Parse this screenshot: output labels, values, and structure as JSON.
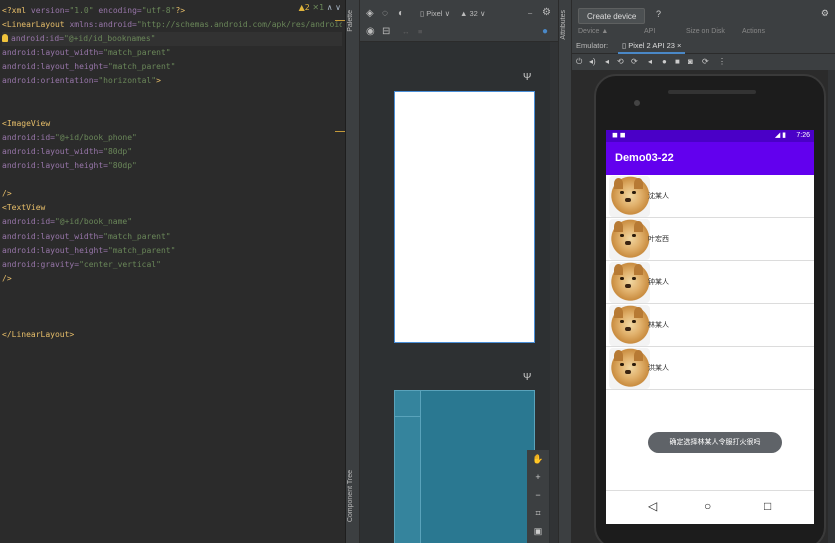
{
  "editor": {
    "status": {
      "warnings": "▲2",
      "checks": "✕1",
      "nav": "∧ ∨"
    },
    "lines": [
      [
        {
          "c": "t",
          "s": "<?xml"
        },
        {
          "c": "a",
          "s": " version="
        },
        {
          "c": "v",
          "s": "\"1.0\""
        },
        {
          "c": "a",
          "s": " encoding="
        },
        {
          "c": "v",
          "s": "\"utf-8\""
        },
        {
          "c": "t",
          "s": "?>"
        }
      ],
      [
        {
          "c": "t",
          "s": "<LinearLayout"
        },
        {
          "c": "a",
          "s": " xmlns:android="
        },
        {
          "c": "v",
          "s": "\"http://schemas.android.com/apk/res/android\""
        }
      ],
      [
        {
          "c": "bulb",
          "s": ""
        },
        {
          "c": "a",
          "s": "android:id="
        },
        {
          "c": "v",
          "s": "\"@+id/id_booknames\""
        }
      ],
      [
        {
          "c": "a",
          "s": "    android:layout_width="
        },
        {
          "c": "v",
          "s": "\"match_parent\""
        }
      ],
      [
        {
          "c": "a",
          "s": "    android:layout_height="
        },
        {
          "c": "v",
          "s": "\"match_parent\""
        }
      ],
      [
        {
          "c": "a",
          "s": "    android:orientation="
        },
        {
          "c": "v",
          "s": "\"horizontal\""
        },
        {
          "c": "t",
          "s": ">"
        }
      ],
      [],
      [],
      [
        {
          "c": "t",
          "s": "    <ImageView"
        }
      ],
      [
        {
          "c": "a",
          "s": "        android:id="
        },
        {
          "c": "v",
          "s": "\"@+id/book_phone\""
        }
      ],
      [
        {
          "c": "a",
          "s": "        android:layout_width="
        },
        {
          "c": "v",
          "s": "\"80dp\""
        }
      ],
      [
        {
          "c": "a",
          "s": "        android:layout_height="
        },
        {
          "c": "v",
          "s": "\"80dp\""
        }
      ],
      [],
      [
        {
          "c": "t",
          "s": "        />"
        }
      ],
      [
        {
          "c": "t",
          "s": "    <TextView"
        }
      ],
      [
        {
          "c": "a",
          "s": "        android:id="
        },
        {
          "c": "v",
          "s": "\"@+id/book_name\""
        }
      ],
      [
        {
          "c": "a",
          "s": "        android:layout_width="
        },
        {
          "c": "v",
          "s": "\"match_parent\""
        }
      ],
      [
        {
          "c": "a",
          "s": "        android:layout_height="
        },
        {
          "c": "v",
          "s": "\"match_parent\""
        }
      ],
      [
        {
          "c": "a",
          "s": "        android:gravity="
        },
        {
          "c": "v",
          "s": "\"center_vertical\""
        }
      ],
      [
        {
          "c": "t",
          "s": "        />"
        }
      ],
      [],
      [],
      [],
      [
        {
          "c": "t",
          "s": "</LinearLayout>"
        }
      ]
    ]
  },
  "palette": {
    "palette_label": "Palette",
    "component_tree_label": "Component Tree"
  },
  "attributes": {
    "label": "Attributes"
  },
  "design": {
    "toolbar": {
      "pixel_label": "Pixel",
      "api_label": "32",
      "dropdown": "∨"
    }
  },
  "emulator": {
    "create_device": "Create device",
    "help": "?",
    "header_cols": [
      "Device ▲",
      "API",
      "Size on Disk",
      "Actions"
    ],
    "tab_emulator": "Emulator:",
    "tab_pixel": "Pixel 2 API 23",
    "tab_close": "×",
    "status_time": "7:26",
    "app_title": "Demo03-22",
    "items": [
      "沈某人",
      "叶宏西",
      "钟某人",
      "林某人",
      "洪某人"
    ],
    "toast": "确定选择林某人令服打火很吗",
    "nav": {
      "back": "◁",
      "home": "○",
      "recent": "□"
    }
  },
  "colors": {
    "app_bar": "#6200ee",
    "status_bar": "#4a00c7",
    "accent": "#4a88c7"
  }
}
